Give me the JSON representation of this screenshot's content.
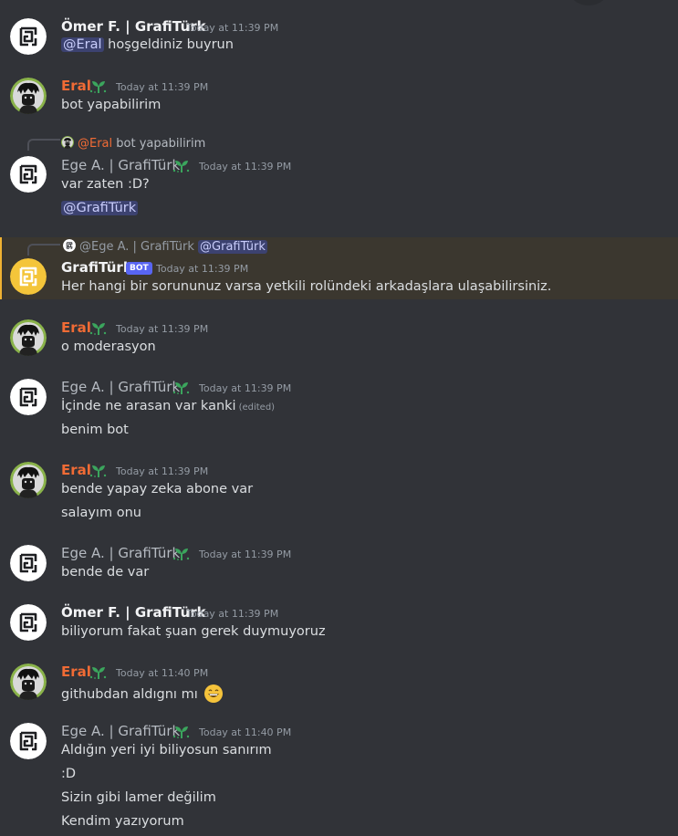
{
  "messages": [
    {
      "author": "Ömer F. | GrafiTürk",
      "time": "Today at 11:39 PM",
      "mention": "@Eral",
      "text": " hoşgeldiniz buyrun"
    },
    {
      "author": "Eral",
      "time": "Today at 11:39 PM",
      "lines": [
        "bot yapabilirim"
      ]
    },
    {
      "reply": {
        "name": "@Eral",
        "text": "bot yapabilirim"
      },
      "author": "Ege A. | GrafiTürk",
      "time": "Today at 11:39 PM",
      "lines": [
        "var zaten :D?"
      ],
      "mention_line": "@GrafiTürk"
    },
    {
      "reply": {
        "name": "@Ege A. | GrafiTürk",
        "mention": "@GrafiTürk"
      },
      "author": "GrafiTürk",
      "badge": "BOT",
      "time": "Today at 11:39 PM",
      "lines": [
        "Her hangi bir sorununuz varsa yetkili rolündeki arkadaşlara ulaşabilirsiniz."
      ]
    },
    {
      "author": "Eral",
      "time": "Today at 11:39 PM",
      "lines": [
        "o moderasyon"
      ]
    },
    {
      "author": "Ege A. | GrafiTürk",
      "time": "Today at 11:39 PM",
      "lines": [
        "İçinde ne arasan var kanki",
        "benim bot"
      ],
      "edited": "(edited)"
    },
    {
      "author": "Eral",
      "time": "Today at 11:39 PM",
      "lines": [
        "bende yapay zeka abone var",
        "salayım onu"
      ]
    },
    {
      "author": "Ege A. | GrafiTürk",
      "time": "Today at 11:39 PM",
      "lines": [
        "bende de var"
      ]
    },
    {
      "author": "Ömer F. | GrafiTürk",
      "time": "Today at 11:39 PM",
      "lines": [
        "biliyorum fakat şuan gerek duymuyoruz"
      ]
    },
    {
      "author": "Eral",
      "time": "Today at 11:40 PM",
      "lines": [
        "githubdan aldıgnı mı"
      ]
    },
    {
      "author": "Ege A. | GrafiTürk",
      "time": "Today at 11:40 PM",
      "lines": [
        "Aldığın yeri iyi biliyosun sanırım",
        ":D",
        "Sizin gibi lamer değilim",
        "Kendim yazıyorum"
      ]
    }
  ],
  "icons": {
    "grafiturk_avatar": "grafiturk-logo-icon",
    "eral_avatar": "eral-avatar",
    "sprout": "sprout-icon",
    "emoji": "grinning-face-emoji"
  },
  "colors": {
    "background": "#313338",
    "highlight": "#3b372f",
    "mention_bg": "#3c4270",
    "eral_name": "#f06b35",
    "bot_badge": "#5865f2"
  }
}
